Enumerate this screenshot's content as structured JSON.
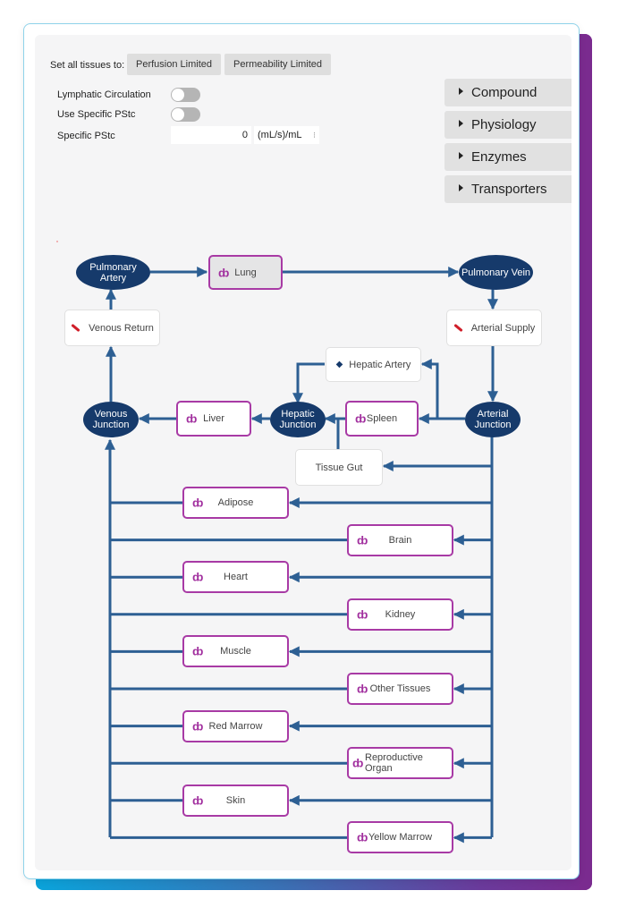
{
  "controls": {
    "set_all_label": "Set all tissues to:",
    "perfusion_button": "Perfusion Limited",
    "permeability_button": "Permeability Limited",
    "lymphatic_label": "Lymphatic Circulation",
    "lymphatic_on": false,
    "use_specific_pstc_label": "Use Specific PStc",
    "use_specific_pstc_on": false,
    "specific_pstc_label": "Specific PStc",
    "specific_pstc_value": "0",
    "specific_pstc_unit": "(mL/s)/mL",
    "spinner_glyph": "⁝"
  },
  "accordion": [
    {
      "label": "Compound",
      "icon": "triangle-right-icon"
    },
    {
      "label": "Physiology",
      "icon": "triangle-right-icon"
    },
    {
      "label": "Enzymes",
      "icon": "triangle-right-icon"
    },
    {
      "label": "Transporters",
      "icon": "triangle-right-icon"
    }
  ],
  "diagram": {
    "organ_icon_glyph": "ȸ",
    "hepatic_artery_glyph": "◆",
    "colors": {
      "junction": "#163a6b",
      "edge": "#2d5f93",
      "organ_border": "#a83aa5",
      "organ_icon": "#a12f9e",
      "vessel_icon": "#d01f2a"
    },
    "junctions": {
      "pulmonary_artery": "Pulmonary Artery",
      "pulmonary_vein": "Pulmonary Vein",
      "venous_junction": "Venous Junction",
      "hepatic_junction": "Hepatic Junction",
      "arterial_junction": "Arterial Junction"
    },
    "vessels": {
      "venous_return": "Venous Return",
      "arterial_supply": "Arterial Supply",
      "hepatic_artery": "Hepatic Artery",
      "tissue_gut": "Tissue Gut"
    },
    "organs": {
      "lung": "Lung",
      "liver": "Liver",
      "spleen": "Spleen"
    },
    "tissues": [
      "Adipose",
      "Brain",
      "Heart",
      "Kidney",
      "Muscle",
      "Other Tissues",
      "Red Marrow",
      "Reproductive Organ",
      "Skin",
      "Yellow Marrow"
    ]
  }
}
